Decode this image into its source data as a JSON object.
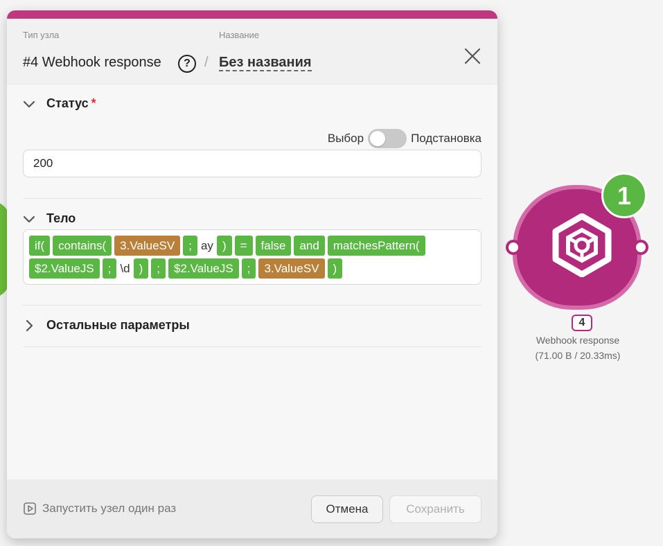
{
  "dialog": {
    "header": {
      "type_caption": "Тип узла",
      "name_caption": "Название",
      "node_type_title": "#4 Webhook response",
      "help": "?",
      "separator": "/",
      "node_name": "Без названия"
    },
    "status": {
      "label": "Статус",
      "required_mark": "*",
      "toggle_left": "Выбор",
      "toggle_right": "Подстановка",
      "value": "200"
    },
    "body": {
      "label": "Тело",
      "tokens": [
        {
          "type": "pill",
          "color": "green",
          "text": "if("
        },
        {
          "type": "pill",
          "color": "green",
          "text": "contains("
        },
        {
          "type": "pill",
          "color": "orange",
          "text": "3.ValueSV"
        },
        {
          "type": "pill",
          "color": "green",
          "text": ";"
        },
        {
          "type": "text",
          "text": "ay"
        },
        {
          "type": "pill",
          "color": "green",
          "text": ")"
        },
        {
          "type": "pill",
          "color": "green",
          "text": "="
        },
        {
          "type": "pill",
          "color": "green",
          "text": "false"
        },
        {
          "type": "pill",
          "color": "green",
          "text": "and"
        },
        {
          "type": "pill",
          "color": "green",
          "text": "matchesPattern("
        },
        {
          "type": "pill",
          "color": "green",
          "text": "$2.ValueJS"
        },
        {
          "type": "pill",
          "color": "green",
          "text": ";"
        },
        {
          "type": "text",
          "text": "\\d"
        },
        {
          "type": "pill",
          "color": "green",
          "text": ")"
        },
        {
          "type": "pill",
          "color": "green",
          "text": ";"
        },
        {
          "type": "pill",
          "color": "green",
          "text": "$2.ValueJS"
        },
        {
          "type": "pill",
          "color": "green",
          "text": ";"
        },
        {
          "type": "pill",
          "color": "orange",
          "text": "3.ValueSV"
        },
        {
          "type": "pill",
          "color": "green",
          "text": ")"
        }
      ]
    },
    "other_params": {
      "label": "Остальные параметры"
    },
    "footer": {
      "run_once": "Запустить узел один раз",
      "cancel": "Отмена",
      "save": "Сохранить"
    }
  },
  "canvas_node": {
    "badge": "1",
    "number": "4",
    "name": "Webhook response",
    "stats": "(71.00 B / 20.33ms)",
    "color": "#b12a7c"
  },
  "colors": {
    "accent": "#c0367f",
    "pill_green": "#5ab744",
    "pill_orange": "#b9803a"
  }
}
